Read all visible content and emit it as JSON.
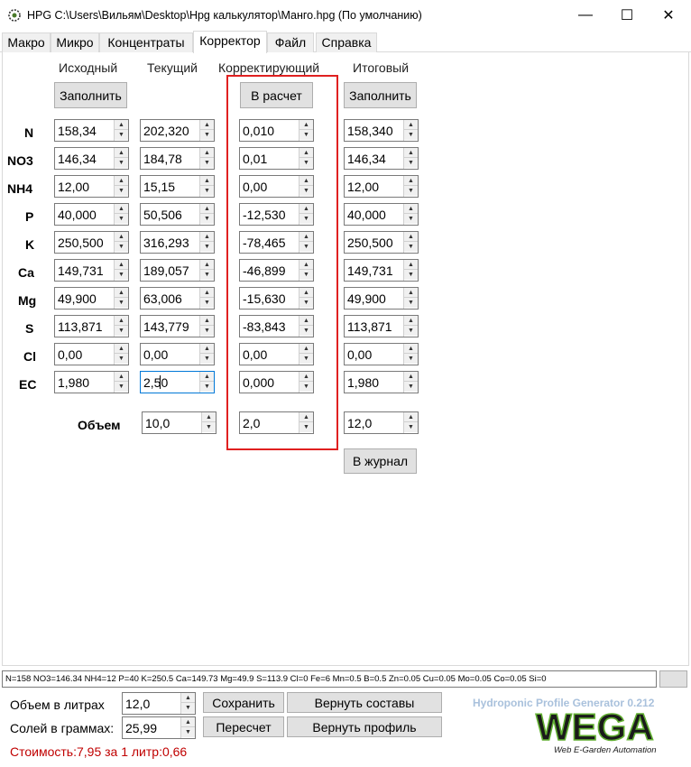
{
  "window": {
    "title": "HPG C:\\Users\\Вильям\\Desktop\\Hpg калькулятор\\Манго.hpg (По умолчанию)",
    "minimize_icon": "—",
    "maximize_icon": "☐",
    "close_icon": "✕"
  },
  "tabs": [
    "Макро",
    "Микро",
    "Концентраты",
    "Корректор",
    "Файл",
    "Справка"
  ],
  "columns": {
    "source": "Исходный",
    "current": "Текущий",
    "correcting": "Корректирующий",
    "final": "Итоговый"
  },
  "buttons": {
    "fill_source": "Заполнить",
    "calculate": "В расчет",
    "fill_final": "Заполнить",
    "to_journal": "В журнал",
    "save": "Сохранить",
    "restore_compositions": "Вернуть составы",
    "recalc": "Пересчет",
    "restore_profile": "Вернуть профиль"
  },
  "rows": [
    {
      "label": "N",
      "source": "158,34",
      "current": "202,320",
      "correcting": "0,010",
      "final": "158,340"
    },
    {
      "label": "NO3",
      "source": "146,34",
      "current": "184,78",
      "correcting": "0,01",
      "final": "146,34"
    },
    {
      "label": "NH4",
      "source": "12,00",
      "current": "15,15",
      "correcting": "0,00",
      "final": "12,00"
    },
    {
      "label": "P",
      "source": "40,000",
      "current": "50,506",
      "correcting": "-12,530",
      "final": "40,000"
    },
    {
      "label": "K",
      "source": "250,500",
      "current": "316,293",
      "correcting": "-78,465",
      "final": "250,500"
    },
    {
      "label": "Ca",
      "source": "149,731",
      "current": "189,057",
      "correcting": "-46,899",
      "final": "149,731"
    },
    {
      "label": "Mg",
      "source": "49,900",
      "current": "63,006",
      "correcting": "-15,630",
      "final": "49,900"
    },
    {
      "label": "S",
      "source": "113,871",
      "current": "143,779",
      "correcting": "-83,843",
      "final": "113,871"
    },
    {
      "label": "Cl",
      "source": "0,00",
      "current": "0,00",
      "correcting": "0,00",
      "final": "0,00"
    },
    {
      "label": "EC",
      "source": "1,980",
      "current": "2,50",
      "correcting": "0,000",
      "final": "1,980"
    }
  ],
  "volume": {
    "label": "Объем",
    "current": "10,0",
    "correcting": "2,0",
    "final": "12,0"
  },
  "status_line": "N=158 NO3=146.34 NH4=12 P=40 K=250.5 Ca=149.73 Mg=49.9 S=113.9 Cl=0 Fe=6 Mn=0.5 B=0.5 Zn=0.05 Cu=0.05 Mo=0.05 Co=0.05 Si=0",
  "bottom": {
    "volume_liters_label": "Объем в литрах",
    "volume_liters_value": "12,0",
    "salts_grams_label": "Солей в граммах:",
    "salts_grams_value": "25,99",
    "cost": "Стоимость:7,95 за 1 литр:0,66",
    "generator": "Hydroponic Profile Generator 0.212",
    "logo_main": "WEGA",
    "logo_sub": "Web E-Garden Automation"
  },
  "spinner_up": "▲",
  "spinner_down": "▼"
}
